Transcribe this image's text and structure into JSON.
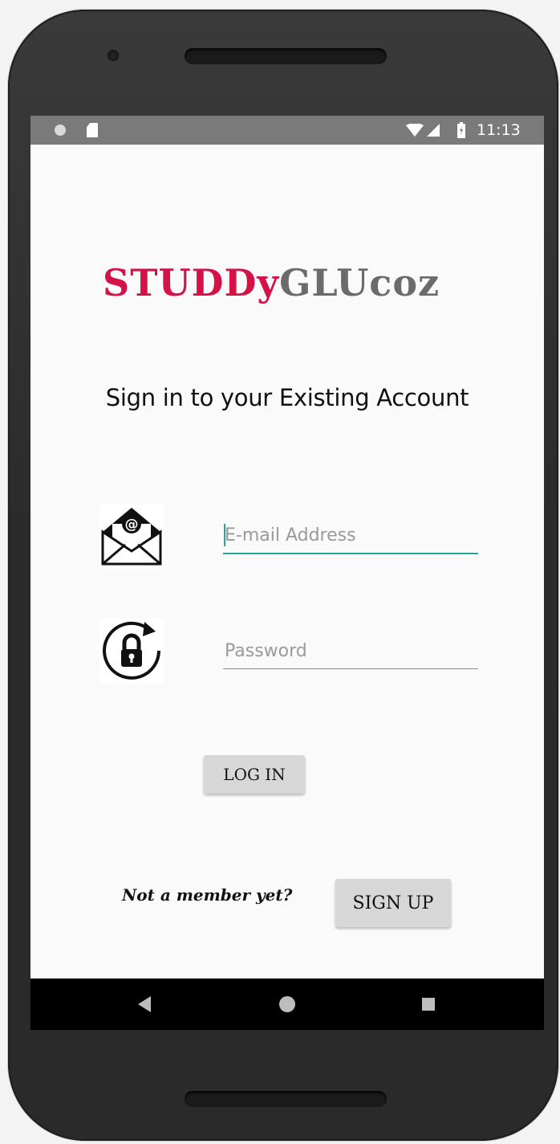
{
  "status_bar": {
    "time": "11:13",
    "icons": [
      "notification-dot-icon",
      "sd-card-icon",
      "wifi-icon",
      "cell-signal-icon",
      "battery-icon"
    ]
  },
  "logo": {
    "part1": "STUDDy",
    "part2": "GLUcoz",
    "color1": "#d41247",
    "color2": "#6b6b6b"
  },
  "subtitle": "Sign in to your Existing Account",
  "email": {
    "value": "",
    "placeholder": "E-mail Address",
    "icon": "mail-icon"
  },
  "password": {
    "value": "",
    "placeholder": "Password",
    "icon": "lock-icon"
  },
  "login_label": "LOG IN",
  "signup": {
    "prompt": "Not a member yet?",
    "label": "SIGN UP"
  },
  "nav_bar": {
    "icons": [
      "back-icon",
      "home-icon",
      "recent-apps-icon"
    ]
  },
  "colors": {
    "accent": "#26a69a",
    "status_bar": "#7a7a7a",
    "button": "#d7d7d7"
  }
}
